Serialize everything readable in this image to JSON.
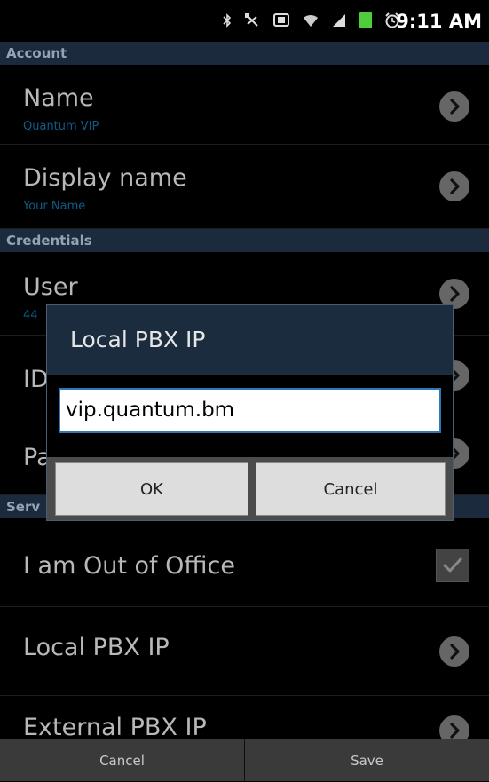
{
  "status_bar": {
    "time": "9:11 AM",
    "icons": [
      "bluetooth-icon",
      "usb-icon",
      "screen-icon",
      "wifi-icon",
      "signal-icon",
      "battery-icon",
      "alarm-icon"
    ]
  },
  "sections": {
    "account": "Account",
    "credentials": "Credentials",
    "services": "Serv"
  },
  "settings": {
    "name": {
      "title": "Name",
      "value": "Quantum VIP"
    },
    "display_name": {
      "title": "Display name",
      "value": "Your Name"
    },
    "user": {
      "title": "User",
      "value": "44"
    },
    "id": {
      "title": "ID"
    },
    "password": {
      "title": "Pa"
    },
    "out_of_office": {
      "title": "I am Out of Office",
      "checked": true
    },
    "local_pbx_ip": {
      "title": "Local PBX IP"
    },
    "external_pbx_ip": {
      "title": "External PBX IP"
    }
  },
  "dialog": {
    "title": "Local PBX IP",
    "input_value": "vip.quantum.bm",
    "ok_label": "OK",
    "cancel_label": "Cancel"
  },
  "bottom_bar": {
    "cancel_label": "Cancel",
    "save_label": "Save"
  },
  "colors": {
    "section_bg": "#1c2a3e",
    "accent_blue": "#0d5d8a",
    "battery_green": "#4fce3b",
    "input_border": "#2c78b8"
  }
}
